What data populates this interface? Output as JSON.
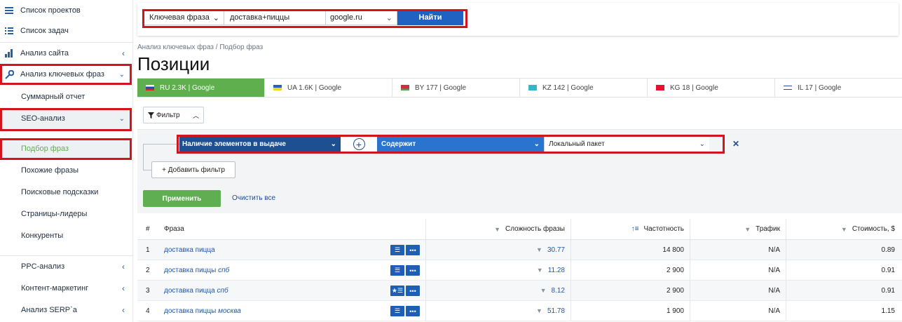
{
  "sidebar": {
    "items": [
      {
        "label": "Список проектов"
      },
      {
        "label": "Список задач"
      },
      {
        "label": "Анализ сайта"
      },
      {
        "label": "Анализ ключевых фраз"
      },
      {
        "label": "Суммарный отчет"
      },
      {
        "label": "SEO-анализ"
      },
      {
        "label": "Подбор фраз"
      },
      {
        "label": "Похожие фразы"
      },
      {
        "label": "Поисковые подсказки"
      },
      {
        "label": "Страницы-лидеры"
      },
      {
        "label": "Конкуренты"
      },
      {
        "label": "PPC-анализ"
      },
      {
        "label": "Контент-маркетинг"
      },
      {
        "label": "Анализ SERP`а"
      }
    ]
  },
  "search": {
    "mode": "Ключевая фраза",
    "query": "доставка+пиццы",
    "engine": "google.ru",
    "button": "Найти"
  },
  "breadcrumb": "Анализ ключевых фраз / Подбор фраз",
  "page_title": "Позиции",
  "db_tabs": [
    {
      "label": "RU 2.3K | Google"
    },
    {
      "label": "UA 1.6K | Google"
    },
    {
      "label": "BY 177 | Google"
    },
    {
      "label": "KZ 142 | Google"
    },
    {
      "label": "KG 18 | Google"
    },
    {
      "label": "IL 17 | Google"
    }
  ],
  "filter": {
    "toggle_label": "Фильтр",
    "field": "Наличие элементов в выдаче",
    "operator": "Содержит",
    "value": "Локальный пакет",
    "add_label": "+ Добавить фильтр",
    "apply_label": "Применить",
    "clear_label": "Очистить все"
  },
  "table": {
    "headers": {
      "num": "#",
      "phrase": "Фраза",
      "difficulty": "Сложность фразы",
      "frequency": "Частотность",
      "traffic": "Трафик",
      "cost": "Стоимость, $"
    },
    "rows": [
      {
        "num": "1",
        "phrase": "доставка пицца",
        "suffix": "",
        "difficulty": "30.77",
        "frequency": "14 800",
        "traffic": "N/A",
        "cost": "0.89"
      },
      {
        "num": "2",
        "phrase": "доставка пиццы",
        "suffix": "спб",
        "difficulty": "11.28",
        "frequency": "2 900",
        "traffic": "N/A",
        "cost": "0.91"
      },
      {
        "num": "3",
        "phrase": "доставка пицца",
        "suffix": "спб",
        "difficulty": "8.12",
        "frequency": "2 900",
        "traffic": "N/A",
        "cost": "0.91"
      },
      {
        "num": "4",
        "phrase": "доставка пиццы",
        "suffix": "москва",
        "difficulty": "51.78",
        "frequency": "1 900",
        "traffic": "N/A",
        "cost": "1.15"
      }
    ]
  },
  "colors": {
    "accent": "#1f62c2",
    "green": "#5faf4f",
    "highlight": "#d0151c"
  }
}
